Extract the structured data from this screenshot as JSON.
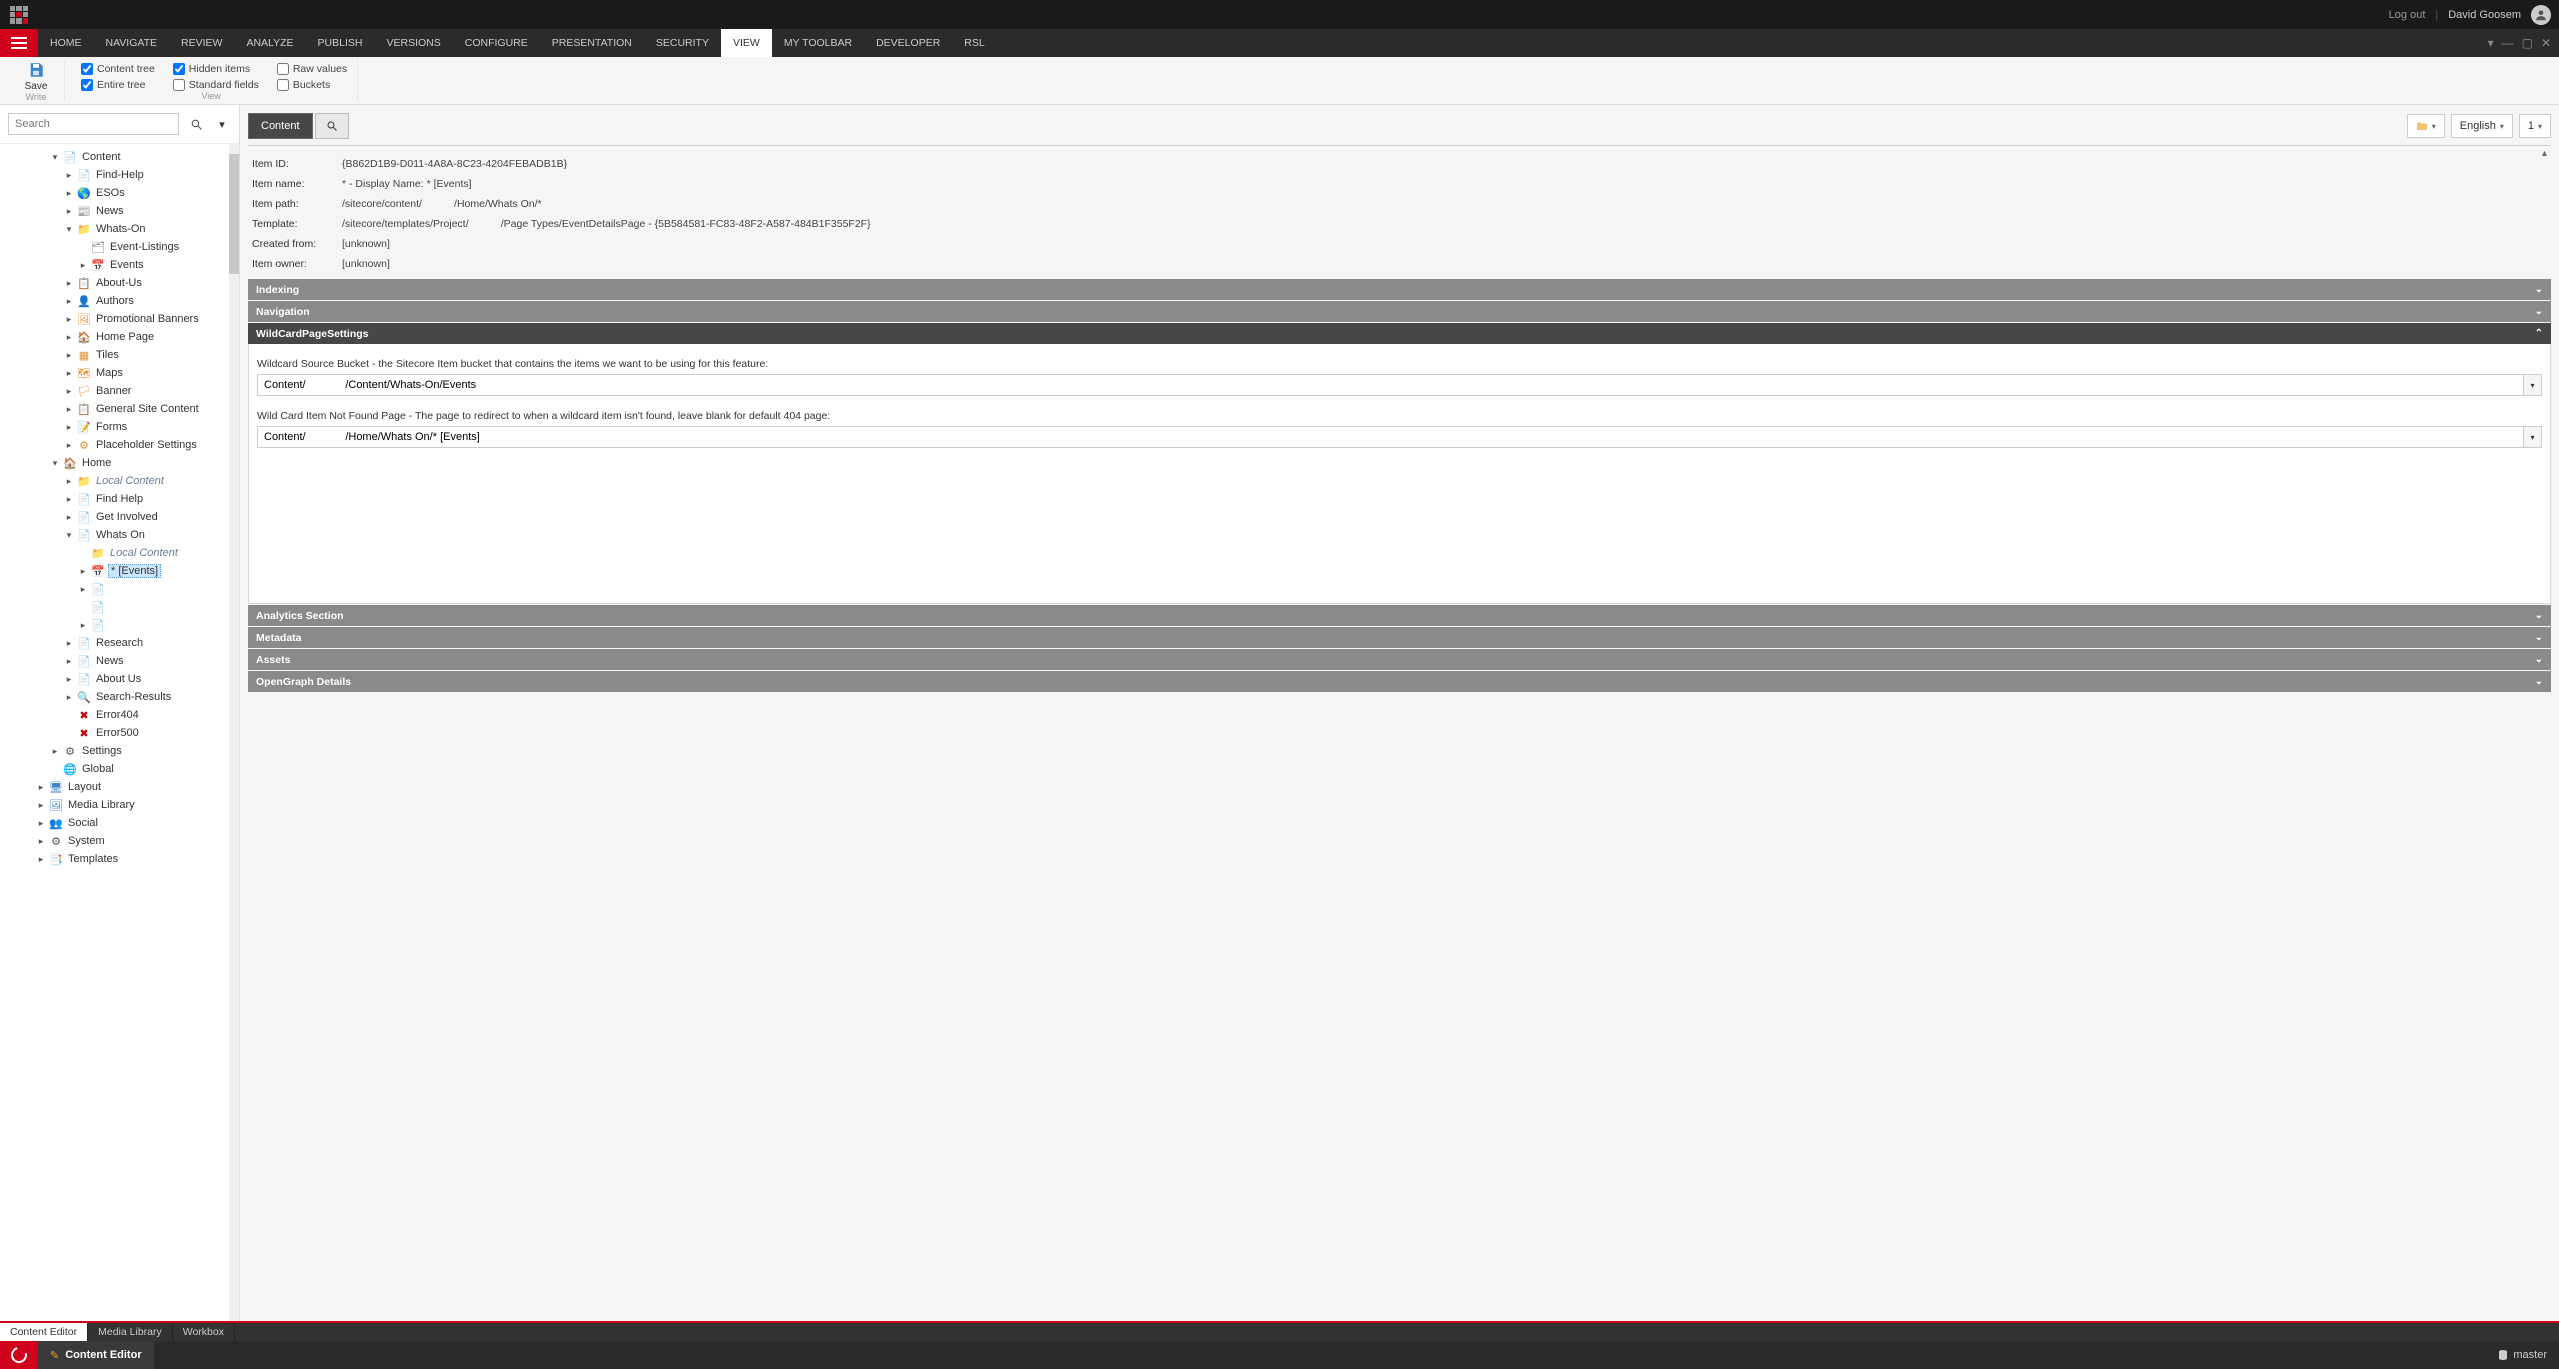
{
  "topbar": {
    "logout": "Log out",
    "user": "David Goosem"
  },
  "menubar": {
    "tabs": [
      "HOME",
      "NAVIGATE",
      "REVIEW",
      "ANALYZE",
      "PUBLISH",
      "VERSIONS",
      "CONFIGURE",
      "PRESENTATION",
      "SECURITY",
      "VIEW",
      "MY TOOLBAR",
      "DEVELOPER",
      "RSL"
    ],
    "active": "VIEW"
  },
  "ribbon": {
    "save": "Save",
    "save_group": "Write",
    "view_group": "View",
    "checks": {
      "content_tree": {
        "label": "Content tree",
        "checked": true
      },
      "hidden_items": {
        "label": "Hidden items",
        "checked": true
      },
      "raw_values": {
        "label": "Raw values",
        "checked": false
      },
      "entire_tree": {
        "label": "Entire tree",
        "checked": true
      },
      "standard_fields": {
        "label": "Standard fields",
        "checked": false
      },
      "buckets": {
        "label": "Buckets",
        "checked": false
      }
    }
  },
  "search": {
    "placeholder": "Search"
  },
  "tree": {
    "nodes": [
      {
        "depth": 3,
        "arrow": "▾",
        "icon": "📄",
        "iconColor": "#6aa84f",
        "label": "Content"
      },
      {
        "depth": 4,
        "arrow": "▸",
        "icon": "📄",
        "iconColor": "#e69138",
        "label": "Find-Help"
      },
      {
        "depth": 4,
        "arrow": "▸",
        "icon": "🌎",
        "iconColor": "#3d85c6",
        "label": "ESOs"
      },
      {
        "depth": 4,
        "arrow": "▸",
        "icon": "📰",
        "iconColor": "#3d85c6",
        "label": "News"
      },
      {
        "depth": 4,
        "arrow": "▾",
        "icon": "📁",
        "iconColor": "#3d85c6",
        "label": "Whats-On"
      },
      {
        "depth": 5,
        "arrow": "",
        "icon": "🗂",
        "iconColor": "#888",
        "label": "Event-Listings"
      },
      {
        "depth": 5,
        "arrow": "▸",
        "icon": "📅",
        "iconColor": "#3d85c6",
        "label": "Events"
      },
      {
        "depth": 4,
        "arrow": "▸",
        "icon": "📋",
        "iconColor": "#e69138",
        "label": "About-Us"
      },
      {
        "depth": 4,
        "arrow": "▸",
        "icon": "👤",
        "iconColor": "#e69138",
        "label": "Authors"
      },
      {
        "depth": 4,
        "arrow": "▸",
        "icon": "🖼",
        "iconColor": "#e69138",
        "label": "Promotional Banners"
      },
      {
        "depth": 4,
        "arrow": "▸",
        "icon": "🏠",
        "iconColor": "#e69138",
        "label": "Home Page"
      },
      {
        "depth": 4,
        "arrow": "▸",
        "icon": "▦",
        "iconColor": "#e69138",
        "label": "Tiles"
      },
      {
        "depth": 4,
        "arrow": "▸",
        "icon": "🗺",
        "iconColor": "#e69138",
        "label": "Maps"
      },
      {
        "depth": 4,
        "arrow": "▸",
        "icon": "🏳",
        "iconColor": "#e69138",
        "label": "Banner"
      },
      {
        "depth": 4,
        "arrow": "▸",
        "icon": "📋",
        "iconColor": "#e69138",
        "label": "General Site Content"
      },
      {
        "depth": 4,
        "arrow": "▸",
        "icon": "📝",
        "iconColor": "#e69138",
        "label": "Forms"
      },
      {
        "depth": 4,
        "arrow": "▸",
        "icon": "⚙",
        "iconColor": "#e69138",
        "label": "Placeholder Settings"
      },
      {
        "depth": 3,
        "arrow": "▾",
        "icon": "🏠",
        "iconColor": "#3d85c6",
        "label": "Home"
      },
      {
        "depth": 4,
        "arrow": "▸",
        "icon": "📁",
        "iconColor": "#6fa8dc",
        "label": "Local Content",
        "italic": true
      },
      {
        "depth": 4,
        "arrow": "▸",
        "icon": "📄",
        "iconColor": "#3d85c6",
        "label": "Find Help"
      },
      {
        "depth": 4,
        "arrow": "▸",
        "icon": "📄",
        "iconColor": "#3d85c6",
        "label": "Get Involved"
      },
      {
        "depth": 4,
        "arrow": "▾",
        "icon": "📄",
        "iconColor": "#3d85c6",
        "label": "Whats On"
      },
      {
        "depth": 5,
        "arrow": "",
        "icon": "📁",
        "iconColor": "#6fa8dc",
        "label": "Local Content",
        "italic": true
      },
      {
        "depth": 5,
        "arrow": "▸",
        "icon": "📅",
        "iconColor": "#e69138",
        "label": "* [Events]",
        "selected": true
      },
      {
        "depth": 5,
        "arrow": "▸",
        "icon": "📄",
        "iconColor": "#3d85c6",
        "label": ""
      },
      {
        "depth": 5,
        "arrow": "",
        "icon": "📄",
        "iconColor": "#3d85c6",
        "label": ""
      },
      {
        "depth": 5,
        "arrow": "▸",
        "icon": "📄",
        "iconColor": "#3d85c6",
        "label": ""
      },
      {
        "depth": 4,
        "arrow": "▸",
        "icon": "📄",
        "iconColor": "#3d85c6",
        "label": "Research"
      },
      {
        "depth": 4,
        "arrow": "▸",
        "icon": "📄",
        "iconColor": "#3d85c6",
        "label": "News"
      },
      {
        "depth": 4,
        "arrow": "▸",
        "icon": "📄",
        "iconColor": "#3d85c6",
        "label": "About Us"
      },
      {
        "depth": 4,
        "arrow": "▸",
        "icon": "🔍",
        "iconColor": "#3d85c6",
        "label": "Search-Results"
      },
      {
        "depth": 4,
        "arrow": "",
        "icon": "✖",
        "iconColor": "#cc0000",
        "label": "Error404"
      },
      {
        "depth": 4,
        "arrow": "",
        "icon": "✖",
        "iconColor": "#cc0000",
        "label": "Error500"
      },
      {
        "depth": 3,
        "arrow": "▸",
        "icon": "⚙",
        "iconColor": "#555",
        "label": "Settings"
      },
      {
        "depth": 3,
        "arrow": "",
        "icon": "🌐",
        "iconColor": "#e69138",
        "label": "Global"
      },
      {
        "depth": 2,
        "arrow": "▸",
        "icon": "🖥",
        "iconColor": "#3d85c6",
        "label": "Layout"
      },
      {
        "depth": 2,
        "arrow": "▸",
        "icon": "🖼",
        "iconColor": "#3d85c6",
        "label": "Media Library"
      },
      {
        "depth": 2,
        "arrow": "▸",
        "icon": "👥",
        "iconColor": "#6aa84f",
        "label": "Social"
      },
      {
        "depth": 2,
        "arrow": "▸",
        "icon": "⚙",
        "iconColor": "#555",
        "label": "System"
      },
      {
        "depth": 2,
        "arrow": "▸",
        "icon": "📑",
        "iconColor": "#e69138",
        "label": "Templates"
      }
    ]
  },
  "content": {
    "tab_content": "Content",
    "lang": "English",
    "version": "1",
    "quickinfo": {
      "item_id_label": "Item ID:",
      "item_id": "{B862D1B9-D011-4A8A-8C23-4204FEBADB1B}",
      "item_name_label": "Item name:",
      "item_name": "* - Display Name: * [Events]",
      "item_path_label": "Item path:",
      "item_path": "/sitecore/content/           /Home/Whats On/*",
      "template_label": "Template:",
      "template": "/sitecore/templates/Project/           /Page Types/EventDetailsPage - {5B584581-FC83-48F2-A587-484B1F355F2F}",
      "created_from_label": "Created from:",
      "created_from": "[unknown]",
      "item_owner_label": "Item owner:",
      "item_owner": "[unknown]"
    },
    "sections": {
      "indexing": "Indexing",
      "navigation": "Navigation",
      "wildcard": "WildCardPageSettings",
      "analytics": "Analytics Section",
      "metadata": "Metadata",
      "assets": "Assets",
      "opengraph": "OpenGraph Details"
    },
    "wildcard_fields": {
      "source_label": "Wildcard Source Bucket - the Sitecore Item bucket that contains the items we want to be using for this feature:",
      "source_value": "Content/             /Content/Whats-On/Events",
      "notfound_label": "Wild Card Item Not Found Page - The page to redirect to when a wildcard item isn't found, leave blank for default 404 page:",
      "notfound_value": "Content/             /Home/Whats On/* [Events]"
    }
  },
  "bottom_tabs": [
    "Content Editor",
    "Media Library",
    "Workbox"
  ],
  "status": {
    "editor": "Content Editor",
    "db_label": "master"
  }
}
